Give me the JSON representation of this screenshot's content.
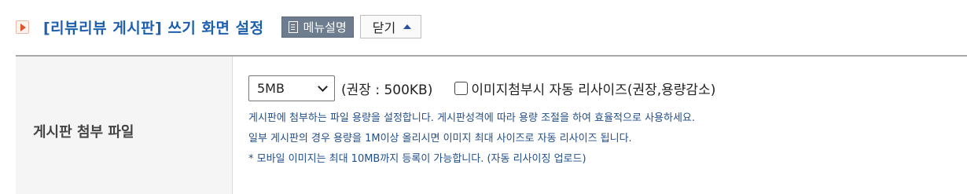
{
  "header": {
    "title": "[리뷰리뷰 게시판] 쓰기 화면 설정",
    "icon": "play-icon",
    "manual_button": "메뉴설명",
    "close_button": "닫기"
  },
  "row": {
    "label": "게시판 첨부 파일",
    "select_value": "5MB",
    "recommend_text": "(권장 : 500KB)",
    "checkbox_label": "이미지첨부시 자동 리사이즈(권장,용량감소)",
    "checkbox_checked": false,
    "help_lines": [
      "게시판에 첨부하는 파일 용량을 설정합니다. 게시판성격에 따라 용량 조절을 하여 효율적으로 사용하세요.",
      "일부 게시판의 경우 용량을 1M이상 올리시면 이미지 최대 사이즈로 자동 리사이즈 됩니다.",
      "* 모바일 이미지는 최대 10MB까지 등록이 가능합니다. (자동 리사이징 업로드)"
    ]
  },
  "colors": {
    "title": "#1f5fb0",
    "help_text": "#1f4e8c",
    "manual_button_bg": "#6d7c8f",
    "label_bg": "#f5f5f5"
  }
}
